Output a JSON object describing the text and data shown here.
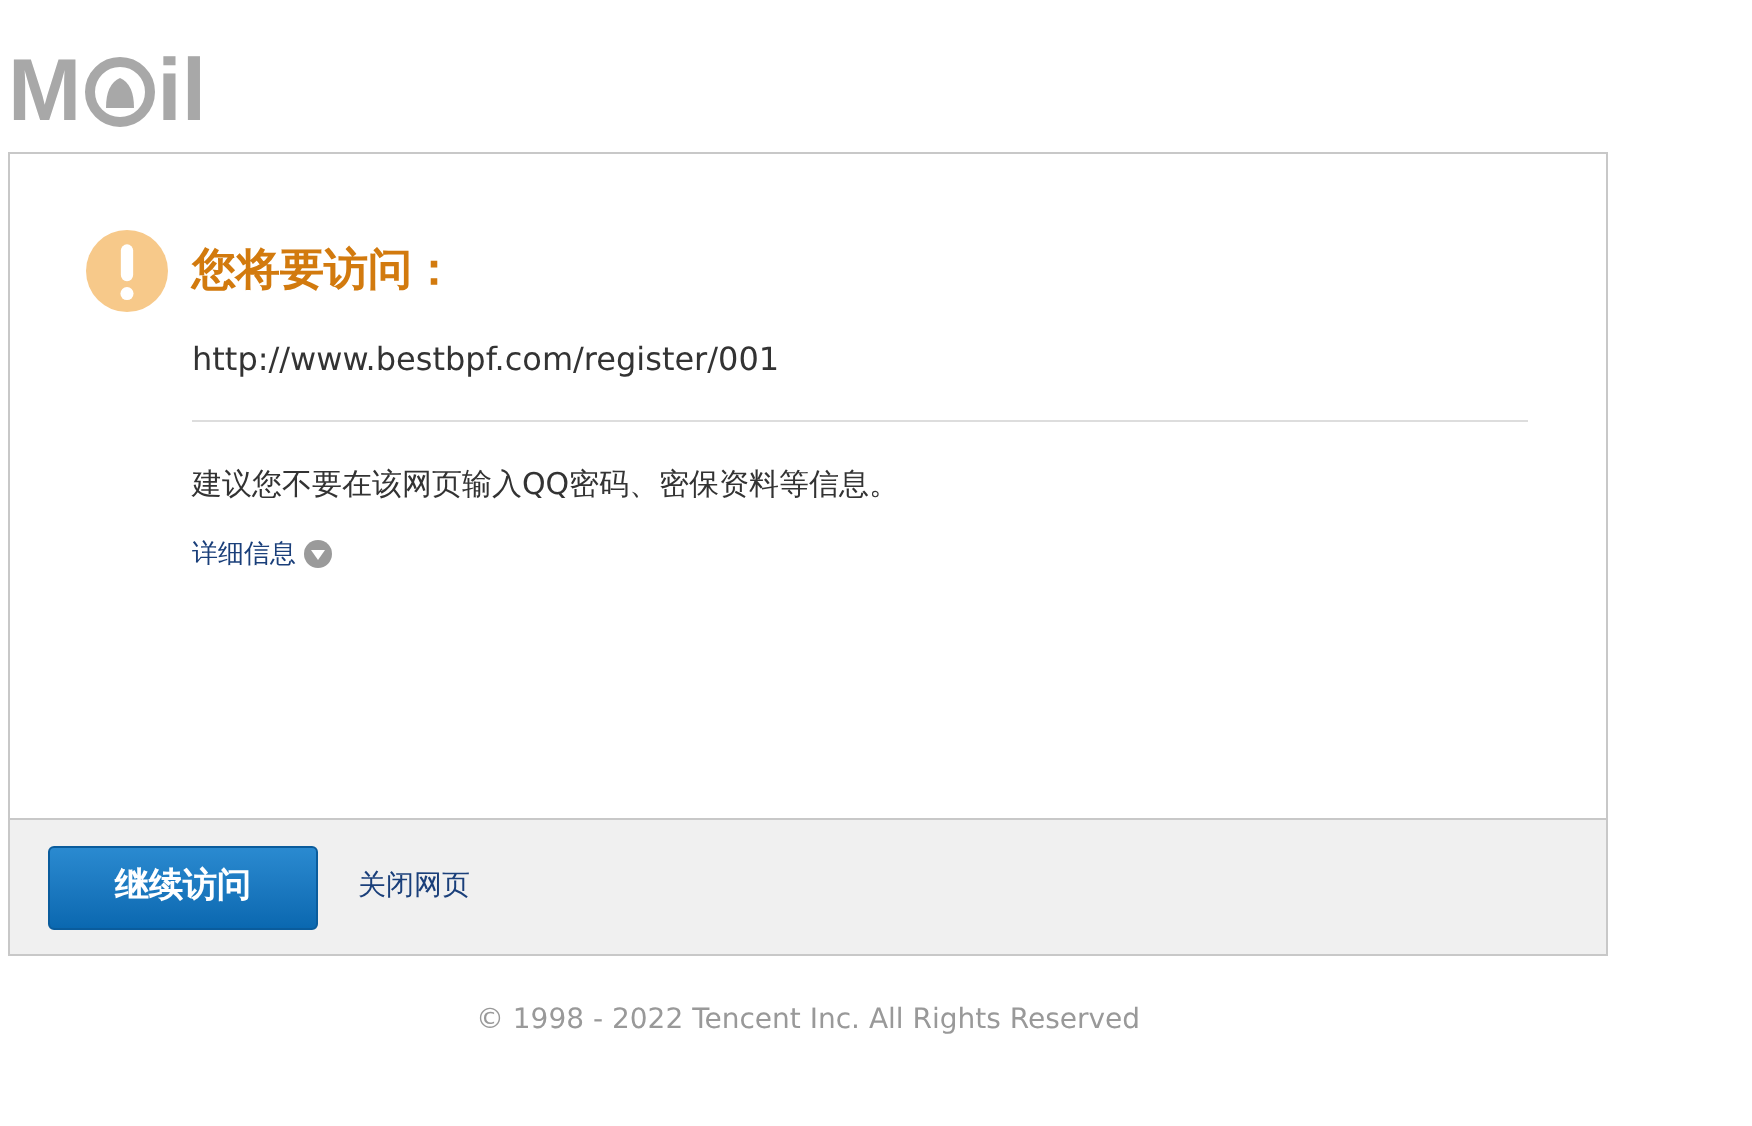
{
  "logo": {
    "letter_1": "M",
    "letters_2": "il"
  },
  "warning": {
    "title": "您将要访问：",
    "url": "http://www.bestbpf.com/register/001",
    "advice": "建议您不要在该网页输入QQ密码、密保资料等信息。",
    "details_link": {
      "label": "详细信息",
      "expanded": false
    }
  },
  "actions": {
    "primary": "继续访问",
    "secondary": "关闭网页"
  },
  "footer": "© 1998 - 2022 Tencent Inc. All Rights Reserved"
}
